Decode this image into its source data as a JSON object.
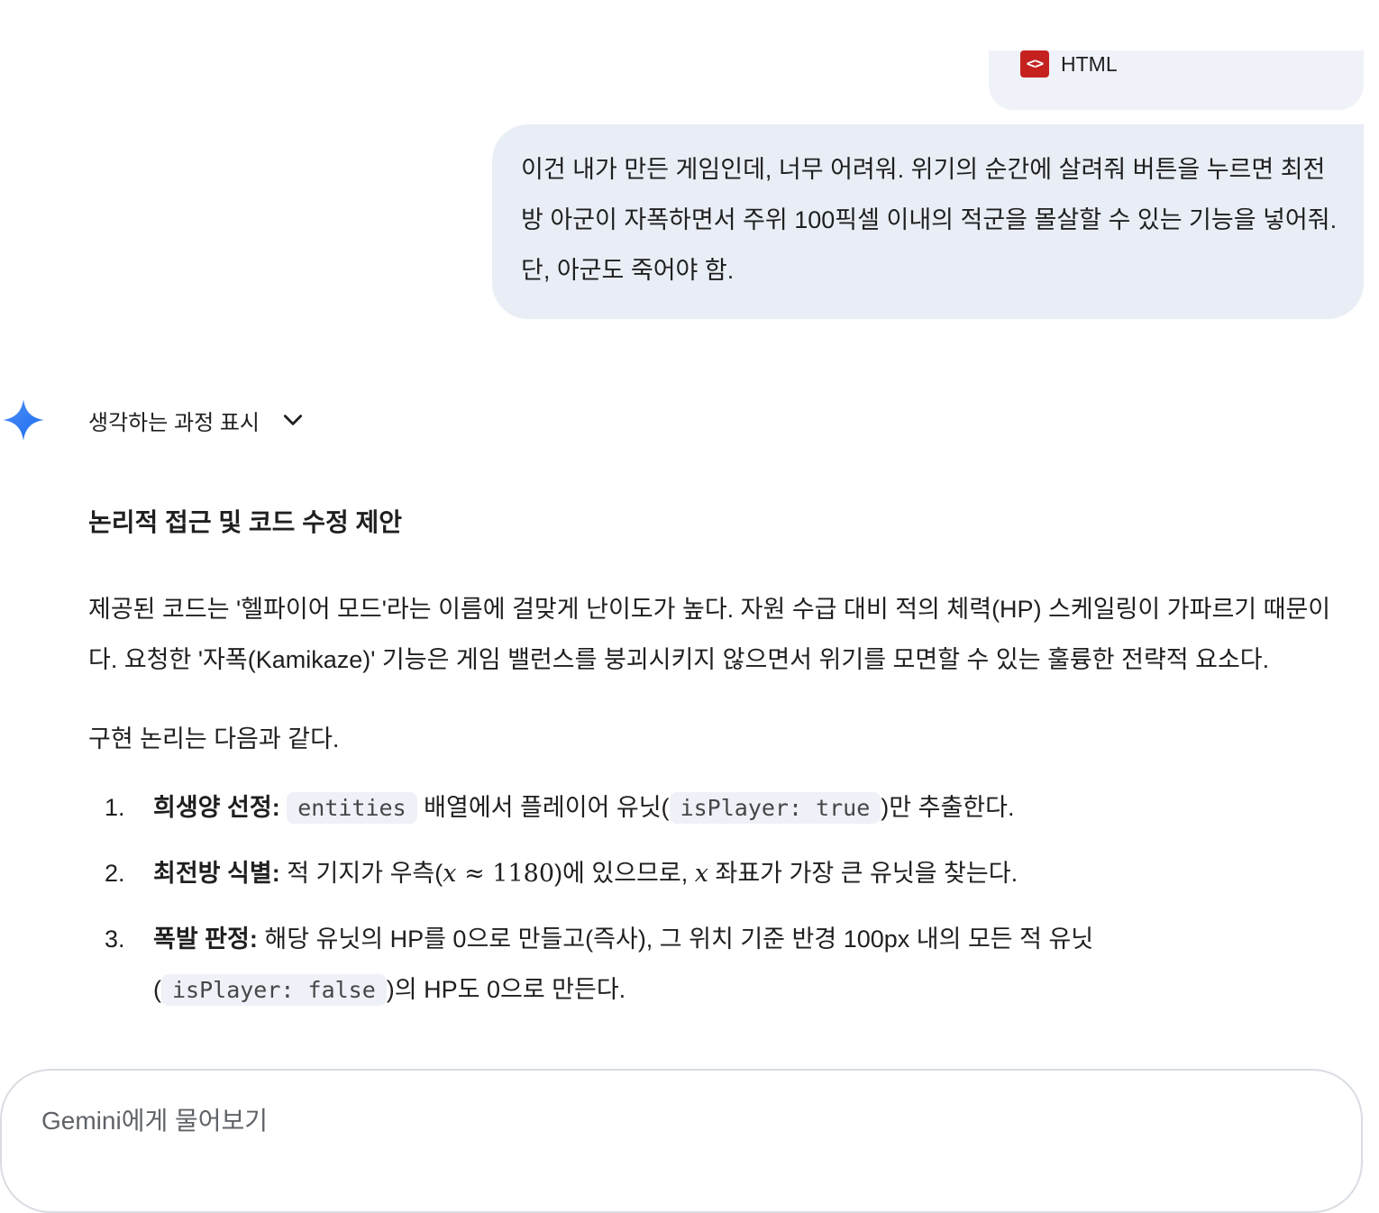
{
  "attachment": {
    "icon": "code-icon",
    "icon_glyph": "<>",
    "type_label": "HTML",
    "icon_color": "#c5221f"
  },
  "user_message": {
    "text": "이건 내가 만든 게임인데, 너무 어려워. 위기의 순간에 살려줘 버튼을 누르면 최전방 아군이 자폭하면서 주위 100픽셀 이내의 적군을 몰살할 수 있는 기능을 넣어줘. 단, 아군도 죽어야 함."
  },
  "thinking": {
    "label": "생각하는 과정 표시",
    "icon": "chevron-down-icon"
  },
  "response": {
    "heading": "논리적 접근 및 코드 수정 제안",
    "paragraph1": "제공된 코드는 '헬파이어 모드'라는 이름에 걸맞게 난이도가 높다. 자원 수급 대비 적의 체력(HP) 스케일링이 가파르기 때문이다. 요청한 '자폭(Kamikaze)' 기능은 게임 밸런스를 붕괴시키지 않으면서 위기를 모면할 수 있는 훌륭한 전략적 요소다.",
    "paragraph2": "구현 논리는 다음과 같다.",
    "steps": [
      {
        "num": "1.",
        "title": "희생양 선정:",
        "code1": "entities",
        "mid": "배열에서 플레이어 유닛(",
        "code2": "isPlayer: true",
        "end": ")만 추출한다."
      },
      {
        "num": "2.",
        "title": "최전방 식별:",
        "pre": "적 기지가 우측(",
        "math_var": "x",
        "math_rel": " ≈ 1180",
        "post": ")에 있으므로,",
        "math_var2": "x",
        "end": "좌표가 가장 큰 유닛을 찾는다."
      },
      {
        "num": "3.",
        "title": "폭발 판정:",
        "pre": "해당 유닛의 HP를 0으로 만들고(즉사), 그 위치 기준 반경 100px 내의 모든 적 유닛",
        "open": "(",
        "code": "isPlayer: false",
        "end": ")의 HP도 0으로 만든다."
      }
    ]
  },
  "input": {
    "placeholder": "Gemini에게 물어보기"
  }
}
